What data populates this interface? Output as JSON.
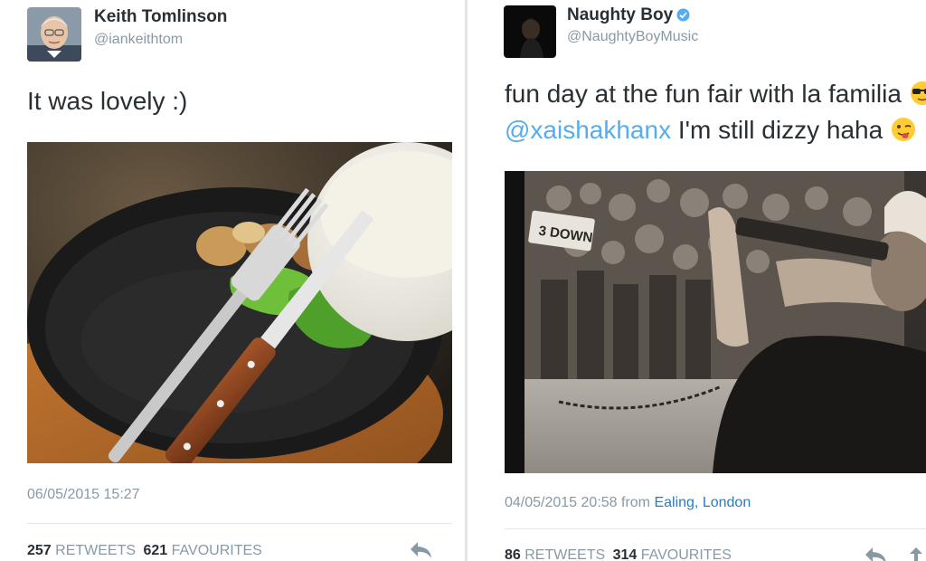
{
  "left_tweet": {
    "author_name": "Keith Tomlinson",
    "author_handle": "@iankeithtom",
    "text": "It was lovely :)",
    "timestamp": "06/05/2015 15:27",
    "retweets_count": "257",
    "retweets_label": "RETWEETS",
    "favourites_count": "621",
    "favourites_label": "FAVOURITES",
    "icons": {
      "reply": "reply-icon",
      "avatar": "avatar-photo",
      "media": "food-plate-photo"
    }
  },
  "right_tweet": {
    "author_name": "Naughty Boy",
    "author_handle": "@NaughtyBoyMusic",
    "verified": true,
    "text_line1": "fun day at the fun fair with la familia",
    "mention": "@xaishakhanx",
    "text_line2_rest": " I'm still dizzy haha",
    "timestamp": "04/05/2015 20:58",
    "from_label": " from ",
    "location": "Ealing, London",
    "retweets_count": "86",
    "retweets_label": "RETWEETS",
    "favourites_count": "314",
    "favourites_label": "FAVOURITES",
    "icons": {
      "reply": "reply-icon",
      "retweet": "retweet-icon",
      "verified": "verified-badge-icon",
      "emoji1": "sunglasses-emoji",
      "emoji2": "winking-tongue-emoji",
      "media": "fun-fair-photo"
    }
  },
  "colors": {
    "link": "#55acee",
    "muted": "#8899a6",
    "text": "#292f33",
    "location": "#2b7bb9"
  }
}
